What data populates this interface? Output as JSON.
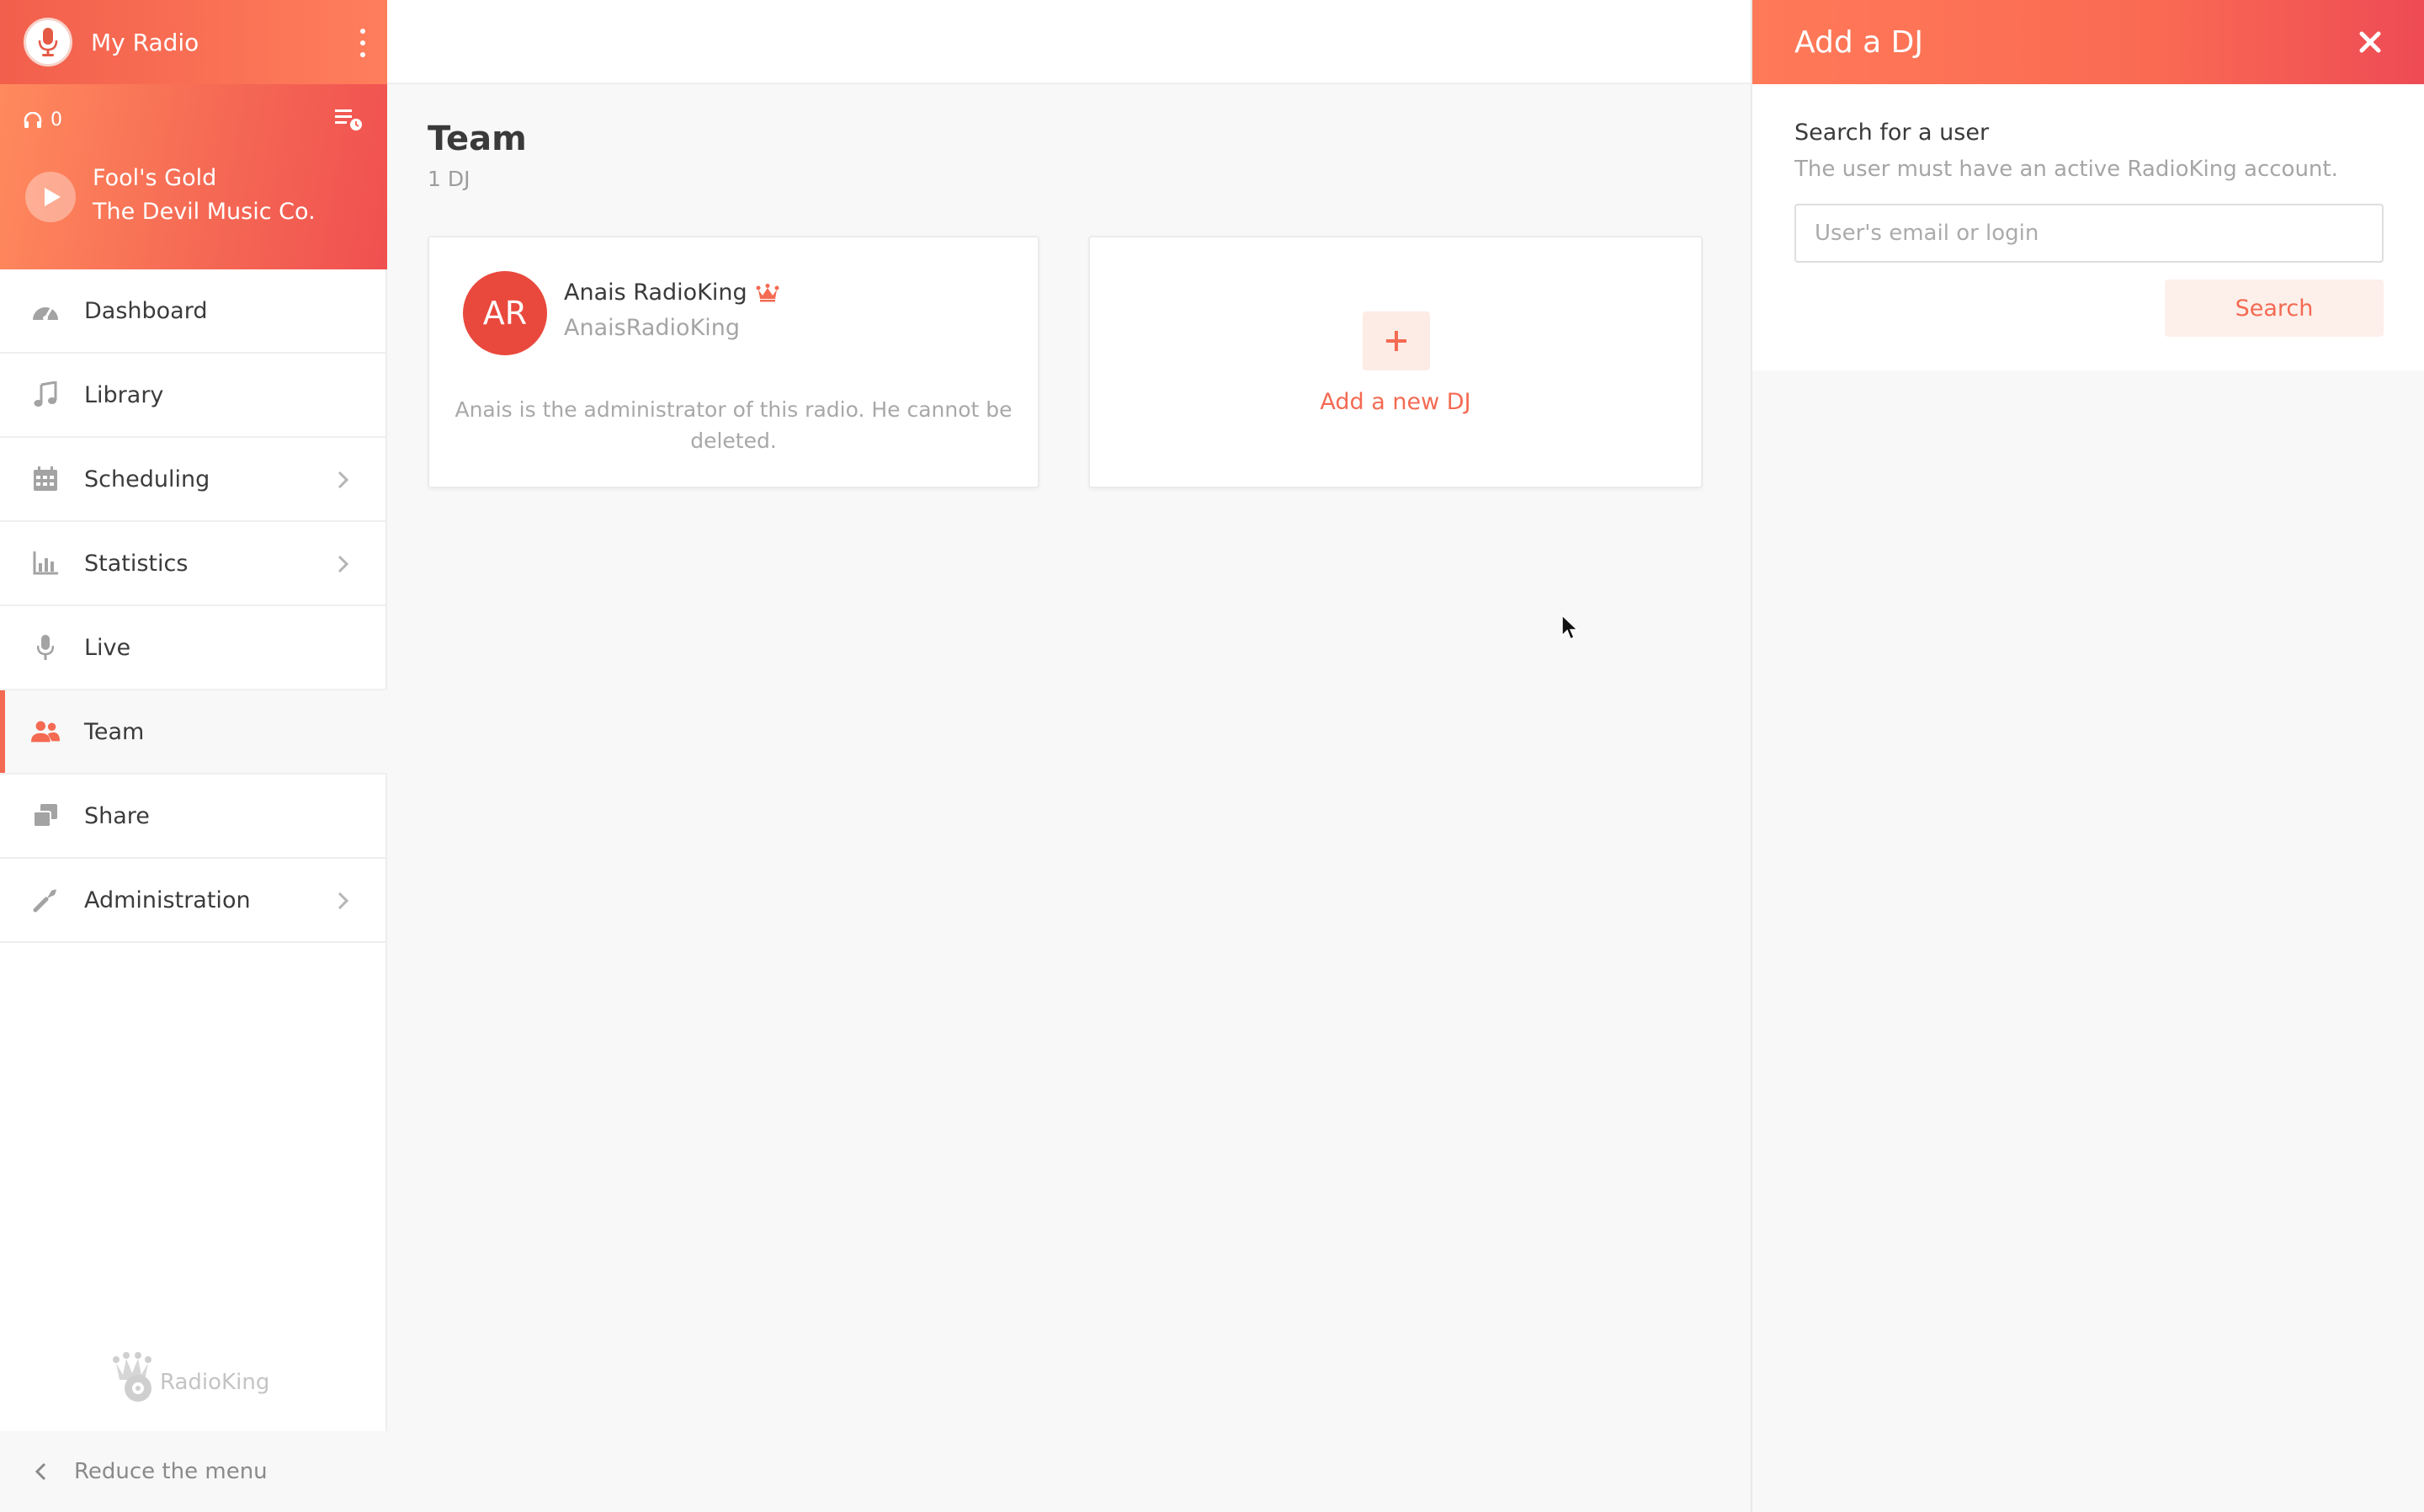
{
  "sidebar": {
    "brand": {
      "name": "My Radio"
    },
    "player": {
      "listeners": "0",
      "song_title": "Fool's Gold",
      "song_artist": "The Devil Music Co."
    },
    "items": [
      {
        "label": "Dashboard",
        "icon": "gauge-icon"
      },
      {
        "label": "Library",
        "icon": "music-note-icon"
      },
      {
        "label": "Scheduling",
        "icon": "calendar-icon"
      },
      {
        "label": "Statistics",
        "icon": "bar-chart-icon"
      },
      {
        "label": "Live",
        "icon": "microphone-icon"
      },
      {
        "label": "Team",
        "icon": "users-icon"
      },
      {
        "label": "Share",
        "icon": "share-icon"
      },
      {
        "label": "Administration",
        "icon": "wrench-icon"
      }
    ],
    "logo_text": "RadioKing",
    "reduce_label": "Reduce the menu"
  },
  "main": {
    "title": "Team",
    "subtitle": "1 DJ",
    "dj": {
      "initials": "AR",
      "name": "Anais RadioKing",
      "login": "AnaisRadioKing",
      "note": "Anais is the administrator of this radio. He cannot be deleted."
    },
    "add_dj_label": "Add a new DJ"
  },
  "panel": {
    "title": "Add a DJ",
    "search_title": "Search for a user",
    "search_hint": "The user must have an active RadioKing account.",
    "search_placeholder": "User's email or login",
    "search_button": "Search"
  },
  "colors": {
    "accent": "#f46a52",
    "avatar": "#e9493c"
  }
}
